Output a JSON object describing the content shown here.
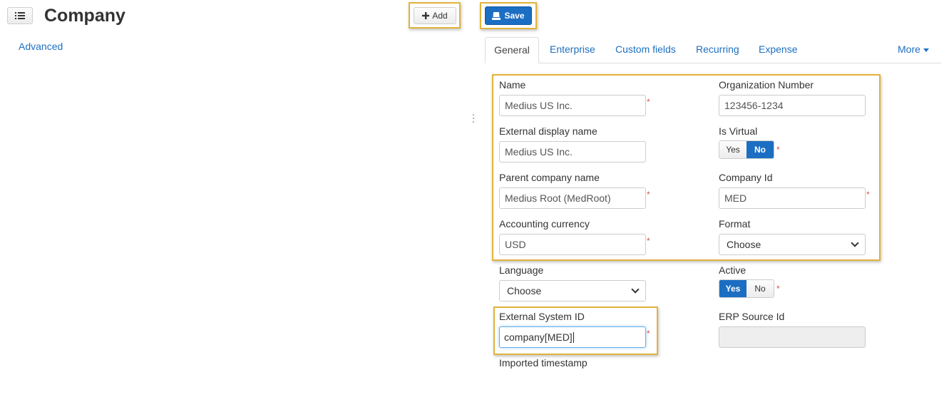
{
  "header": {
    "title": "Company",
    "add_label": "Add",
    "save_label": "Save"
  },
  "sidebar": {
    "advanced_link": "Advanced"
  },
  "tabs": [
    {
      "label": "General"
    },
    {
      "label": "Enterprise"
    },
    {
      "label": "Custom fields"
    },
    {
      "label": "Recurring"
    },
    {
      "label": "Expense"
    },
    {
      "label": "More"
    }
  ],
  "form": {
    "name": {
      "label": "Name",
      "value": "Medius US Inc."
    },
    "org_number": {
      "label": "Organization Number",
      "value": "123456-1234"
    },
    "external_display_name": {
      "label": "External display name",
      "value": "Medius US Inc."
    },
    "is_virtual": {
      "label": "Is Virtual",
      "yes": "Yes",
      "no": "No",
      "selected": "No"
    },
    "parent_company": {
      "label": "Parent company name",
      "value": "Medius Root (MedRoot)"
    },
    "company_id": {
      "label": "Company Id",
      "value": "MED"
    },
    "accounting_currency": {
      "label": "Accounting currency",
      "value": "USD"
    },
    "format": {
      "label": "Format",
      "value": "Choose"
    },
    "language": {
      "label": "Language",
      "value": "Choose"
    },
    "active": {
      "label": "Active",
      "yes": "Yes",
      "no": "No",
      "selected": "Yes"
    },
    "external_system_id": {
      "label": "External System ID",
      "value": "company[MED]"
    },
    "erp_source_id": {
      "label": "ERP Source Id",
      "value": ""
    },
    "imported_timestamp": {
      "label": "Imported timestamp"
    },
    "required_marker": "*"
  },
  "icons": {
    "menu": "list-icon",
    "add": "plus-icon",
    "save": "save-icon"
  },
  "colors": {
    "accent": "#1b6ec2",
    "link": "#1e6fc1",
    "highlight": "#e2b33b",
    "required": "#d9534f"
  }
}
